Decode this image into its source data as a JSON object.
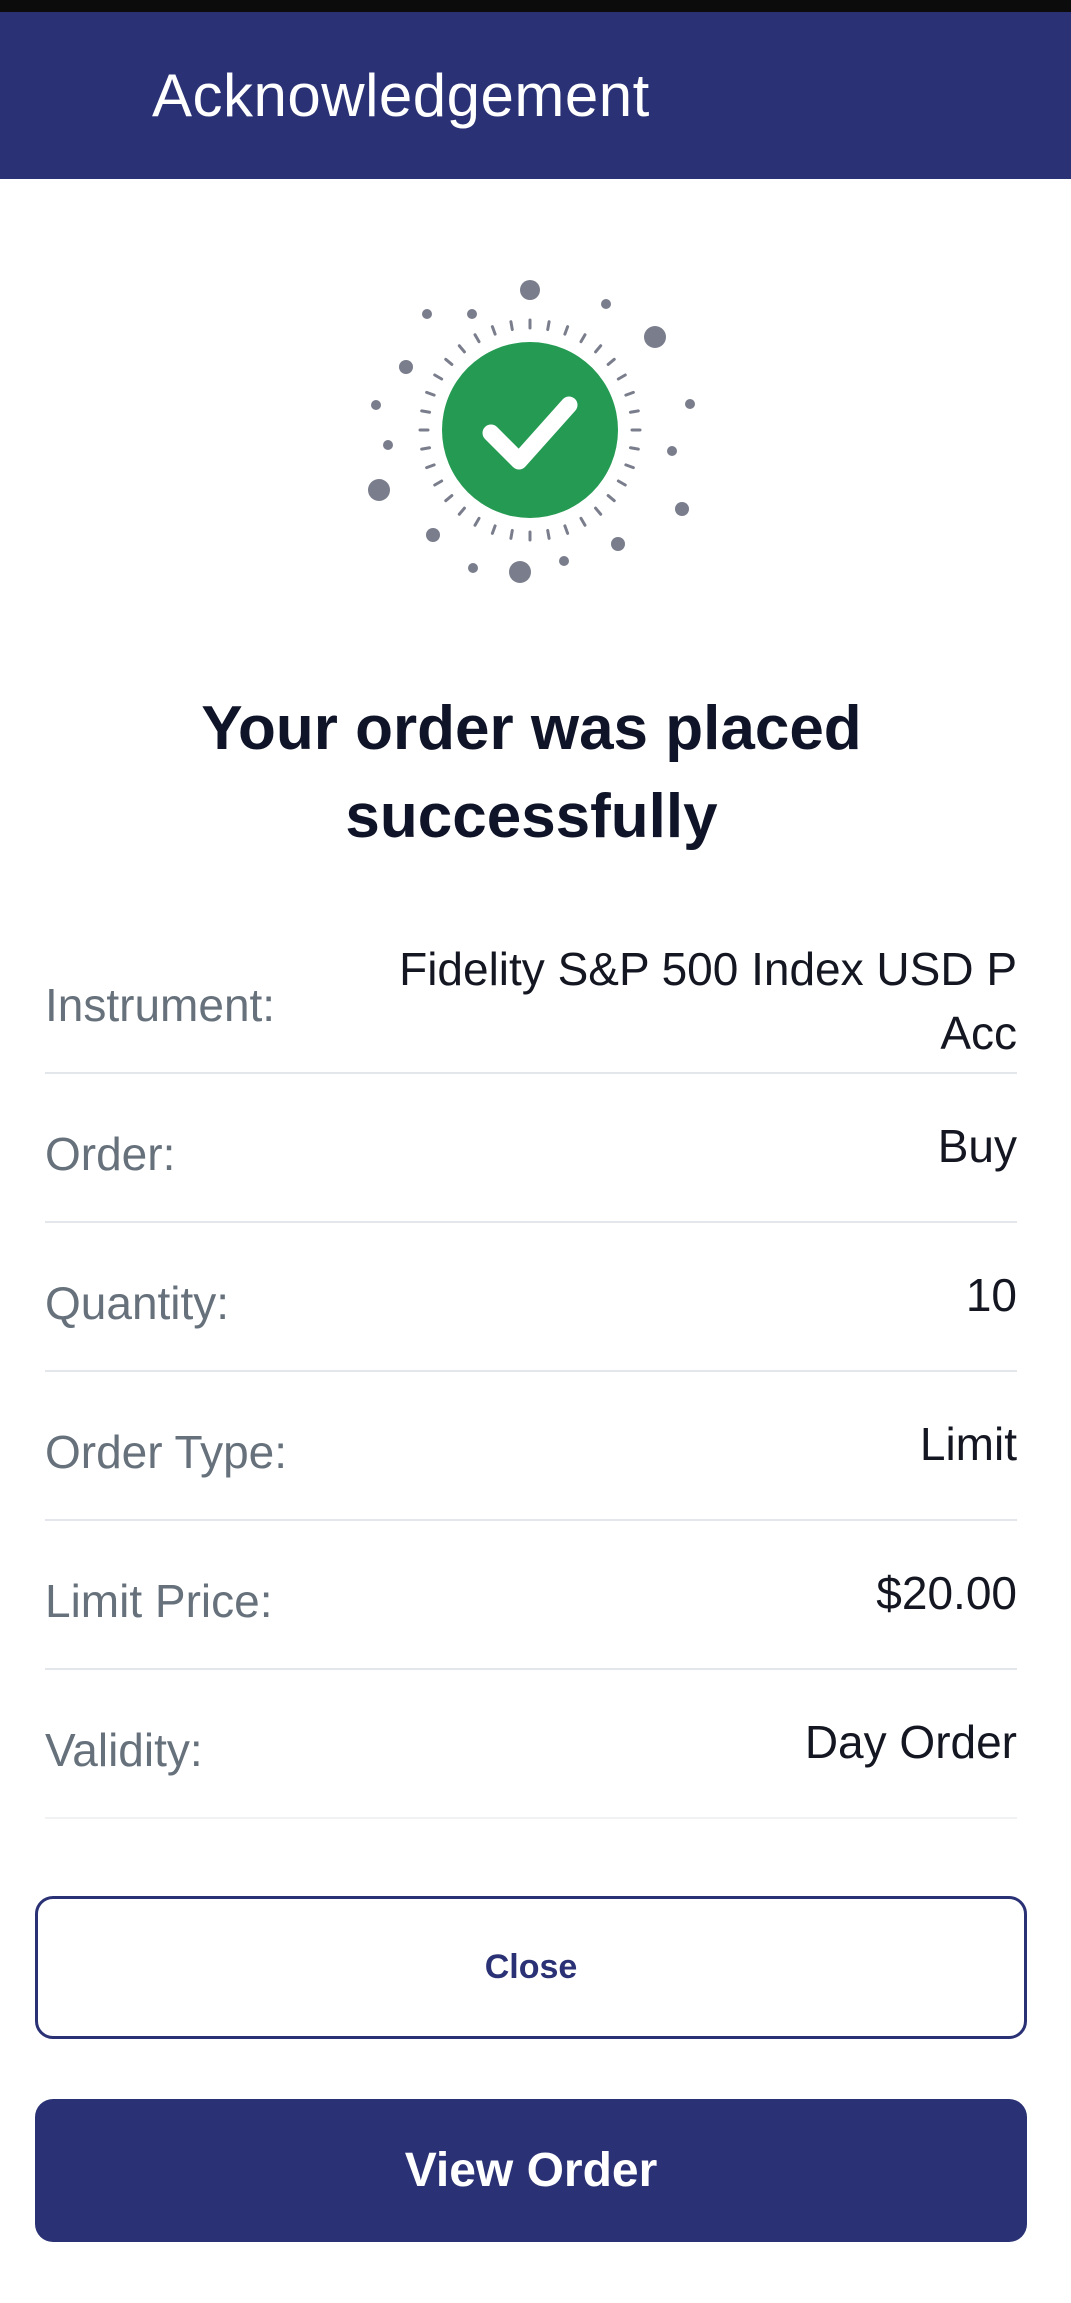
{
  "header": {
    "title": "Acknowledgement"
  },
  "success": {
    "message": "Your order was placed successfully",
    "check_color": "#249a52"
  },
  "details": [
    {
      "label": "Instrument:",
      "value": "Fidelity S&P 500 Index USD P Acc"
    },
    {
      "label": "Order:",
      "value": "Buy"
    },
    {
      "label": "Quantity:",
      "value": "10"
    },
    {
      "label": "Order Type:",
      "value": "Limit"
    },
    {
      "label": "Limit Price:",
      "value": "$20.00"
    },
    {
      "label": "Validity:",
      "value": "Day Order"
    }
  ],
  "buttons": {
    "close_label": "Close",
    "view_order_label": "View Order"
  },
  "colors": {
    "brand": "#2a3275",
    "success": "#249a52"
  }
}
